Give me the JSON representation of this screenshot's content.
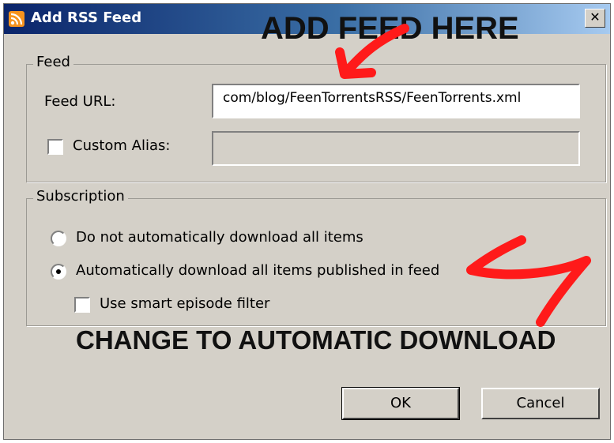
{
  "window": {
    "title": "Add RSS Feed",
    "close_glyph": "✕"
  },
  "feed_group": {
    "label": "Feed",
    "url_label": "Feed URL:",
    "url_value": "com/blog/FeenTorrentsRSS/FeenTorrents.xml",
    "alias_label": "Custom Alias:",
    "alias_checked": false,
    "alias_value": ""
  },
  "subscription_group": {
    "label": "Subscription",
    "option_manual": "Do not automatically download all items",
    "option_auto": "Automatically download all items published in feed",
    "selected": "auto",
    "smart_filter_label": "Use smart episode filter",
    "smart_filter_checked": false
  },
  "buttons": {
    "ok": "OK",
    "cancel": "Cancel"
  },
  "annotations": {
    "top": "ADD FEED HERE",
    "bottom": "CHANGE TO AUTOMATIC DOWNLOAD",
    "arrow_color": "#ff1a1a"
  }
}
